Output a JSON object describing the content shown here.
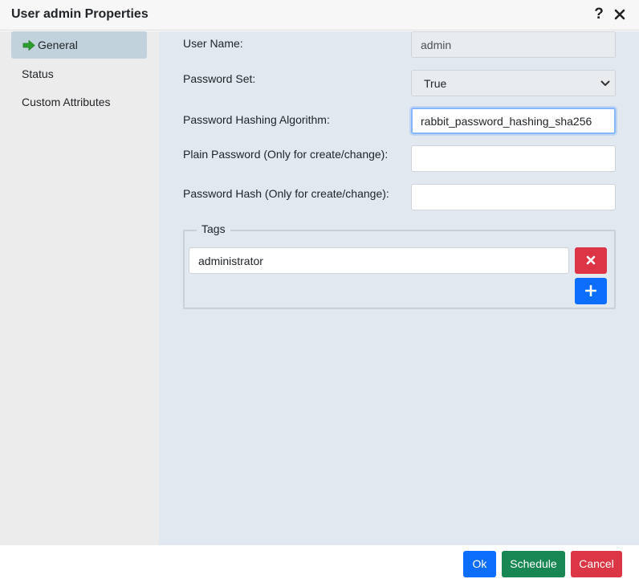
{
  "dialog": {
    "title": "User admin Properties",
    "help_label": "?"
  },
  "sidebar": {
    "items": [
      {
        "label": "General",
        "active": true
      },
      {
        "label": "Status",
        "active": false
      },
      {
        "label": "Custom Attributes",
        "active": false
      }
    ]
  },
  "form": {
    "user_name": {
      "label": "User Name:",
      "value": "admin"
    },
    "password_set": {
      "label": "Password Set:",
      "value": "True"
    },
    "hashing_algorithm": {
      "label": "Password Hashing Algorithm:",
      "value": "rabbit_password_hashing_sha256"
    },
    "plain_password": {
      "label": "Plain Password (Only for create/change):",
      "value": ""
    },
    "password_hash": {
      "label": "Password Hash (Only for create/change):",
      "value": ""
    }
  },
  "tags": {
    "legend": "Tags",
    "items": [
      {
        "value": "administrator"
      }
    ]
  },
  "footer": {
    "ok_label": "Ok",
    "schedule_label": "Schedule",
    "cancel_label": "Cancel"
  },
  "icons": {
    "nav_active": "arrow-right-icon",
    "remove": "times-icon",
    "add": "plus-icon",
    "close": "close-icon",
    "select": "chevron-down-icon"
  },
  "colors": {
    "ok": "#0d6efd",
    "schedule": "#198754",
    "cancel": "#dc3545",
    "active_arrow": "#2e9e2e",
    "active_nav_bg": "#c2d2dc",
    "content_bg": "#e1e8f0"
  }
}
